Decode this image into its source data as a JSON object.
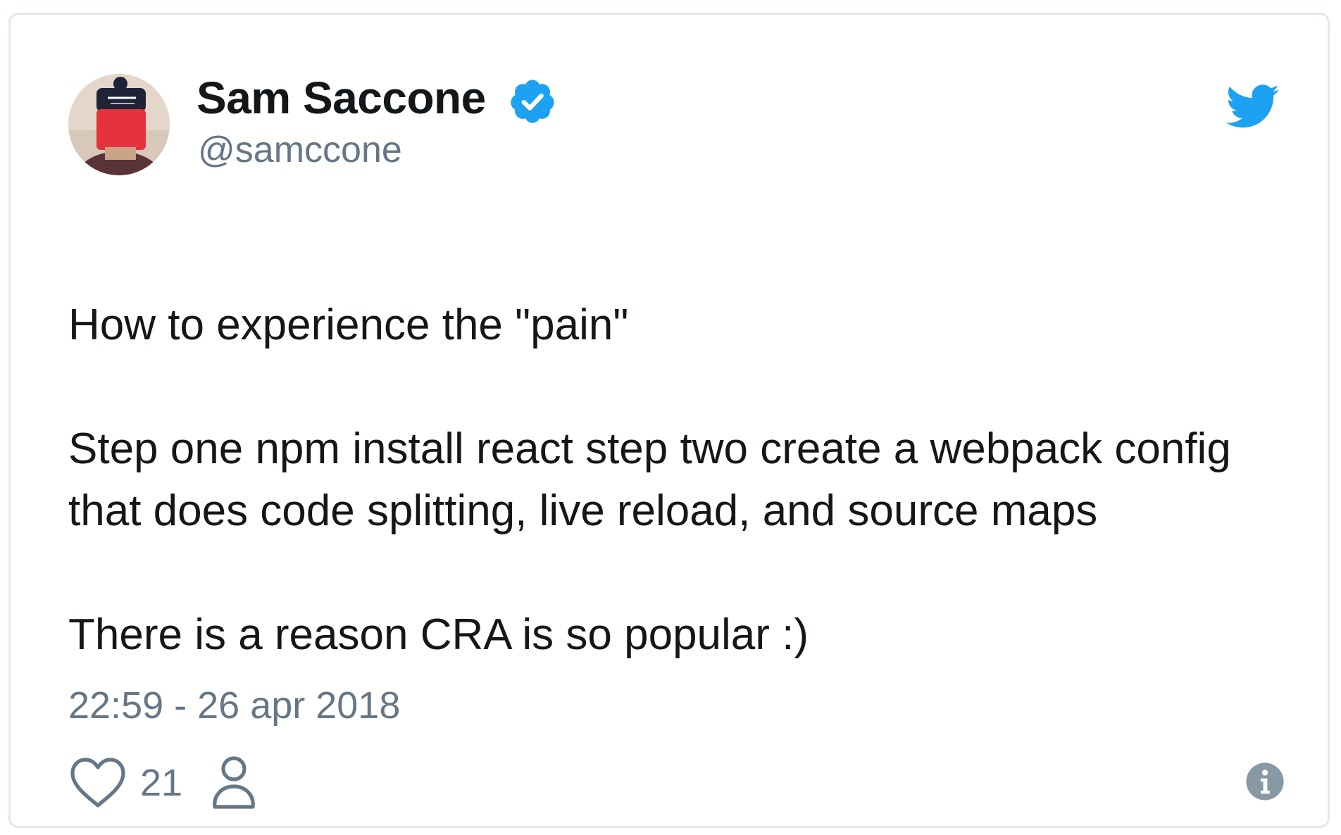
{
  "tweet": {
    "display_name": "Sam Saccone",
    "handle": "@samccone",
    "verified": true,
    "lines": [
      "How to experience the \"pain\"",
      "Step one npm install react step two create a webpack config",
      "that does code splitting, live reload, and source maps",
      "There is a reason CRA is so popular :)"
    ],
    "timestamp": "22:59 - 26 apr 2018",
    "likes": "21"
  },
  "icons": {
    "avatar": "profile-photo-red-beanie",
    "verified": "verified-badge-icon",
    "logo": "twitter-bird-icon",
    "like": "heart-icon",
    "profile": "person-icon",
    "info": "info-icon"
  },
  "colors": {
    "twitter_blue": "#1da1f2",
    "text_primary": "#14171a",
    "text_secondary": "#657786",
    "border": "#e1e8ed"
  }
}
